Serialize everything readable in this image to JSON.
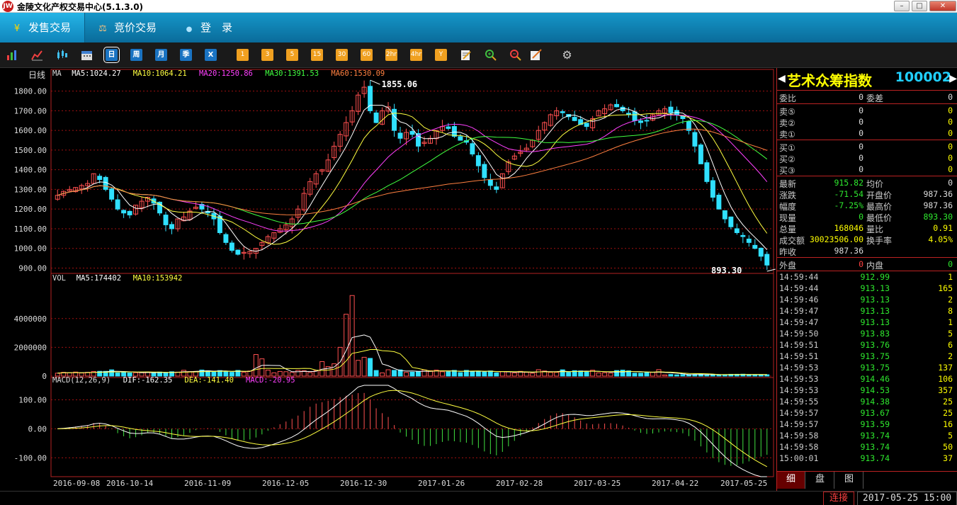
{
  "window": {
    "title": "金陵文化产权交易中心(5.1.3.0)",
    "logo_text": "JW"
  },
  "nav": {
    "tabs": [
      {
        "label": "发售交易",
        "icon": "yen-icon",
        "glyph": "¥"
      },
      {
        "label": "竞价交易",
        "icon": "gavel-icon",
        "glyph": "⚖"
      },
      {
        "label": "登　录",
        "icon": "user-icon",
        "glyph": "●"
      }
    ]
  },
  "toolbar": {
    "periods": [
      "日",
      "周",
      "月",
      "季",
      "X"
    ],
    "minutes": [
      "1",
      "3",
      "5",
      "15",
      "30",
      "60",
      "2hr",
      "4hr",
      "Y"
    ]
  },
  "chart": {
    "period_label": "日线",
    "price_high_label": "1855.06",
    "price_low_label": "893.30",
    "ma_legend": [
      {
        "text": "MA",
        "color": "#dddddd"
      },
      {
        "text": "MA5:1024.27",
        "color": "#ffffff"
      },
      {
        "text": "MA10:1064.21",
        "color": "#ffff40"
      },
      {
        "text": "MA20:1250.86",
        "color": "#ff40ff"
      },
      {
        "text": "MA30:1391.53",
        "color": "#40ff40"
      },
      {
        "text": "MA60:1530.09",
        "color": "#ff8040"
      }
    ],
    "vol_legend": [
      {
        "text": "VOL",
        "color": "#dddddd"
      },
      {
        "text": "MA5:174402",
        "color": "#ffffff"
      },
      {
        "text": "MA10:153942",
        "color": "#ffff40"
      }
    ],
    "macd_legend": [
      {
        "text": "MACD(12,26,9)",
        "color": "#dddddd"
      },
      {
        "text": "DIF:-162.35",
        "color": "#ffffff"
      },
      {
        "text": "DEA:-141.40",
        "color": "#ffff40"
      },
      {
        "text": "MACD:-20.95",
        "color": "#ff40ff"
      }
    ]
  },
  "chart_data": {
    "type": "candlestick",
    "title": "",
    "x_dates": [
      "2016-09-08",
      "2016-10-14",
      "2016-11-09",
      "2016-12-05",
      "2016-12-30",
      "2017-01-26",
      "2017-02-28",
      "2017-03-25",
      "2017-04-22",
      "2017-05-25"
    ],
    "price_axis": {
      "ticks": [
        "900.00",
        "1000.00",
        "1100.00",
        "1200.00",
        "1300.00",
        "1400.00",
        "1500.00",
        "1600.00",
        "1700.00",
        "1800.00"
      ],
      "ylim": [
        880,
        1860
      ]
    },
    "volume_axis": {
      "ticks": [
        "0",
        "2000000",
        "4000000"
      ],
      "ylim": [
        0,
        6400000
      ]
    },
    "macd_axis": {
      "ticks": [
        "-100.00",
        "0.00",
        "100.00"
      ],
      "ylim": [
        -165,
        150
      ]
    },
    "close_series": [
      1270,
      1290,
      1300,
      1310,
      1320,
      1330,
      1380,
      1350,
      1300,
      1250,
      1200,
      1180,
      1170,
      1220,
      1240,
      1260,
      1230,
      1180,
      1120,
      1100,
      1150,
      1160,
      1190,
      1210,
      1200,
      1180,
      1150,
      1080,
      1030,
      990,
      970,
      980,
      985,
      1000,
      1030,
      1060,
      1080,
      1100,
      1120,
      1150,
      1200,
      1280,
      1340,
      1380,
      1400,
      1450,
      1520,
      1580,
      1640,
      1700,
      1780,
      1820,
      1700,
      1640,
      1700,
      1720,
      1600,
      1560,
      1590,
      1580,
      1520,
      1540,
      1560,
      1600,
      1620,
      1610,
      1570,
      1550,
      1540,
      1480,
      1420,
      1360,
      1320,
      1300,
      1380,
      1440,
      1470,
      1490,
      1510,
      1550,
      1600,
      1640,
      1680,
      1700,
      1690,
      1670,
      1650,
      1630,
      1620,
      1660,
      1700,
      1710,
      1730,
      1720,
      1700,
      1680,
      1650,
      1640,
      1650,
      1680,
      1700,
      1710,
      1690,
      1680,
      1660,
      1600,
      1520,
      1430,
      1340,
      1260,
      1200,
      1150,
      1110,
      1080,
      1060,
      1030,
      1000,
      960,
      915
    ],
    "ma_series_names": [
      "MA5",
      "MA10",
      "MA20",
      "MA30",
      "MA60"
    ],
    "volume_ma_names": [
      "MA5",
      "MA10"
    ],
    "macd_series_names": [
      "DIF",
      "DEA",
      "MACD"
    ]
  },
  "quote": {
    "name": "艺术众筹指数",
    "code": "100002",
    "order_rows": [
      {
        "l1": "委比",
        "v1": "0",
        "l2": "委差",
        "v2": "0",
        "c1": "white",
        "c2": "white"
      }
    ],
    "sell_rows": [
      {
        "l1": "卖⑤",
        "v1": "0",
        "v2": "0"
      },
      {
        "l1": "卖②",
        "v1": "0",
        "v2": "0"
      },
      {
        "l1": "卖①",
        "v1": "0",
        "v2": "0"
      }
    ],
    "buy_rows": [
      {
        "l1": "买①",
        "v1": "0",
        "v2": "0"
      },
      {
        "l1": "买②",
        "v1": "0",
        "v2": "0"
      },
      {
        "l1": "买③",
        "v1": "0",
        "v2": "0"
      }
    ],
    "stat_rows": [
      {
        "l1": "最新",
        "v1": "915.82",
        "c1": "green",
        "l2": "均价",
        "v2": "0",
        "c2": "white"
      },
      {
        "l1": "涨跌",
        "v1": "-71.54",
        "c1": "green",
        "l2": "开盘价",
        "v2": "987.36",
        "c2": "white"
      },
      {
        "l1": "幅度",
        "v1": "-7.25%",
        "c1": "green",
        "l2": "最高价",
        "v2": "987.36",
        "c2": "white"
      },
      {
        "l1": "现量",
        "v1": "0",
        "c1": "green",
        "l2": "最低价",
        "v2": "893.30",
        "c2": "green"
      },
      {
        "l1": "总量",
        "v1": "168046",
        "c1": "yellow",
        "l2": "量比",
        "v2": "0.91",
        "c2": "yellow"
      },
      {
        "l1": "成交额",
        "v1": "30023506.00",
        "c1": "yellow",
        "l2": "换手率",
        "v2": "4.05%",
        "c2": "yellow"
      },
      {
        "l1": "昨收",
        "v1": "987.36",
        "c1": "white",
        "l2": "",
        "v2": "",
        "c2": "white"
      }
    ],
    "inout_row": {
      "l1": "外盘",
      "v1": "0",
      "c1": "red",
      "l2": "内盘",
      "v2": "0",
      "c2": "green"
    },
    "ticks": [
      {
        "t": "14:59:44",
        "p": "912.99",
        "q": "1"
      },
      {
        "t": "14:59:44",
        "p": "913.13",
        "q": "165"
      },
      {
        "t": "14:59:46",
        "p": "913.13",
        "q": "2"
      },
      {
        "t": "14:59:47",
        "p": "913.13",
        "q": "8"
      },
      {
        "t": "14:59:47",
        "p": "913.13",
        "q": "1"
      },
      {
        "t": "14:59:50",
        "p": "913.83",
        "q": "5"
      },
      {
        "t": "14:59:51",
        "p": "913.76",
        "q": "6"
      },
      {
        "t": "14:59:51",
        "p": "913.75",
        "q": "2"
      },
      {
        "t": "14:59:53",
        "p": "913.75",
        "q": "137"
      },
      {
        "t": "14:59:53",
        "p": "914.46",
        "q": "106"
      },
      {
        "t": "14:59:53",
        "p": "914.53",
        "q": "357"
      },
      {
        "t": "14:59:55",
        "p": "914.38",
        "q": "25"
      },
      {
        "t": "14:59:57",
        "p": "913.67",
        "q": "25"
      },
      {
        "t": "14:59:57",
        "p": "913.59",
        "q": "16"
      },
      {
        "t": "14:59:58",
        "p": "913.74",
        "q": "5"
      },
      {
        "t": "14:59:58",
        "p": "913.74",
        "q": "50"
      },
      {
        "t": "15:00:01",
        "p": "913.74",
        "q": "37"
      }
    ],
    "tabs": [
      "细",
      "盘",
      "图"
    ]
  },
  "status": {
    "connection": "连接",
    "datetime": "2017-05-25 15:00"
  },
  "colors": {
    "up": "#ff5050",
    "down": "#30e0ff",
    "grid": "#a01010",
    "border": "#b22222"
  }
}
